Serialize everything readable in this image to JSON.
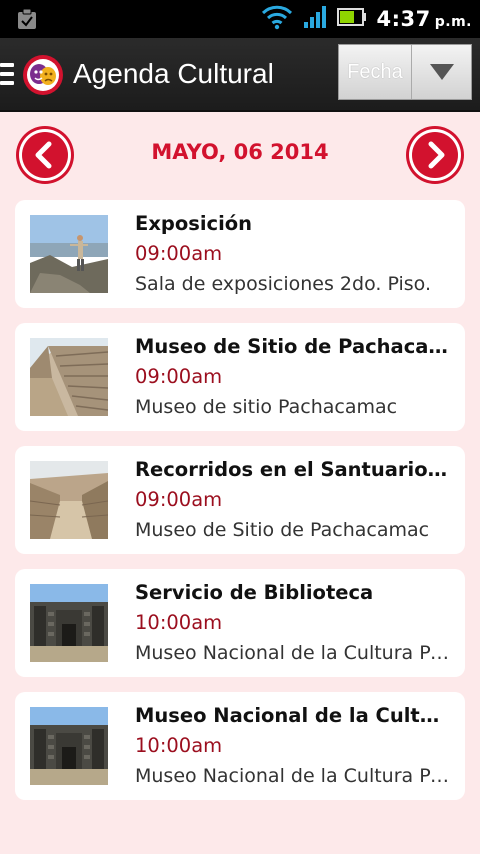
{
  "status_bar": {
    "time": "4:37",
    "ampm": "p.m.",
    "icons": [
      "clipboard-icon",
      "wifi-icon",
      "signal-icon",
      "battery-icon"
    ]
  },
  "action_bar": {
    "title": "Agenda Cultural",
    "filter": {
      "selected": "Fecha"
    }
  },
  "date_nav": {
    "date": "MAYO, 06 2014"
  },
  "events": [
    {
      "title": "Exposición",
      "time": "09:00am",
      "place": "Sala de exposiciones 2do. Piso.",
      "image": "hiker-photo"
    },
    {
      "title": "Museo de Sitio de Pachacamac",
      "time": "09:00am",
      "place": "Museo de sitio Pachacamac",
      "image": "stone-wall-photo"
    },
    {
      "title": "Recorridos en el Santuario Arqueológico de Pachacamac",
      "time": "09:00am",
      "place": "Museo de Sitio de Pachacamac",
      "image": "ruins-path-photo"
    },
    {
      "title": "Servicio de Biblioteca",
      "time": "10:00am",
      "place": "Museo Nacional de la Cultura Peruana",
      "image": "museum-facade-photo"
    },
    {
      "title": "Museo Nacional de la Cultura Peruana",
      "time": "10:00am",
      "place": "Museo Nacional de la Cultura Peruana",
      "image": "museum-facade-photo"
    }
  ],
  "colors": {
    "accent": "#d2122e",
    "time": "#9b0e1e",
    "background": "#fde9ea"
  }
}
